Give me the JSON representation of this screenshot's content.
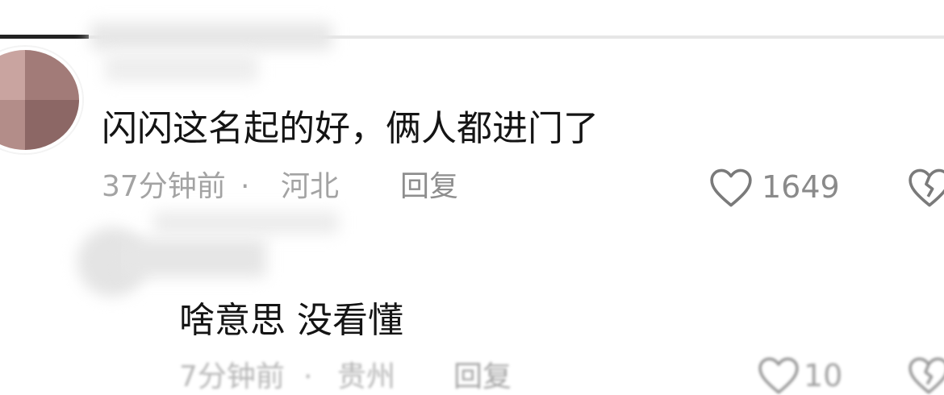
{
  "comments": [
    {
      "text": "闪闪这名起的好，俩人都进门了",
      "time": "37分钟前",
      "separator": "·",
      "location": "河北",
      "reply_label": "回复",
      "like_count": "1649"
    },
    {
      "text": "啥意思 没看懂",
      "time": "7分钟前",
      "separator": "·",
      "location": "贵州",
      "reply_label": "回复",
      "like_count": "10"
    }
  ],
  "icons": [
    "heart-icon",
    "dislike-icon"
  ],
  "colors": {
    "text": "#141414",
    "meta": "#a3a3a3",
    "icon_stroke": "#7a7a7a",
    "background": "#ffffff"
  }
}
